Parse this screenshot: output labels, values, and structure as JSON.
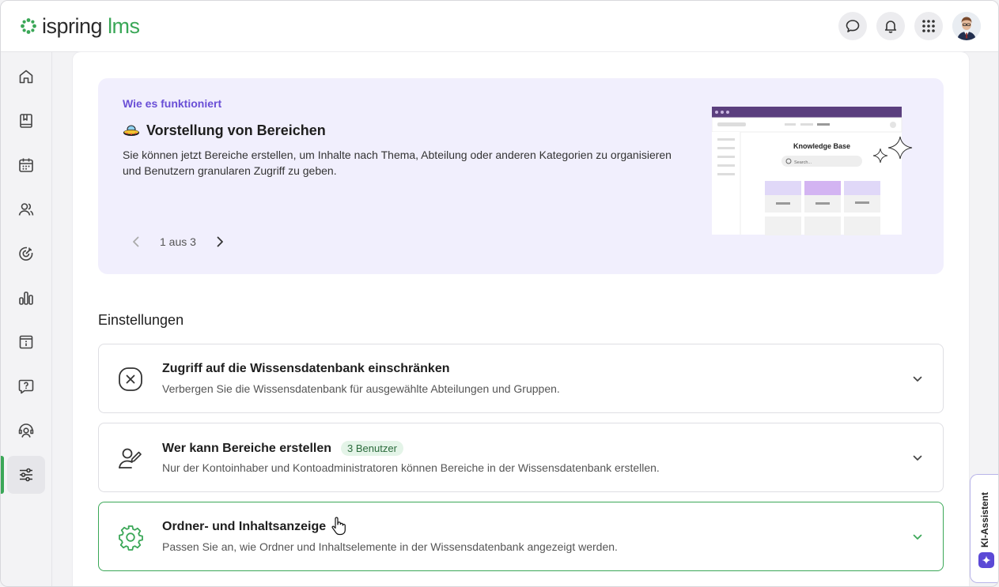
{
  "app": {
    "logo_text_main": "ispring",
    "logo_text_accent": "lms",
    "brand_color": "#3aa757",
    "accent_purple": "#6a4fd6"
  },
  "header": {
    "icons": [
      "chat-icon",
      "bell-icon",
      "apps-grid-icon",
      "avatar"
    ]
  },
  "sidebar": {
    "items": [
      {
        "icon": "home-icon"
      },
      {
        "icon": "book-icon"
      },
      {
        "icon": "calendar-icon"
      },
      {
        "icon": "users-icon"
      },
      {
        "icon": "target-icon"
      },
      {
        "icon": "bar-chart-icon"
      },
      {
        "icon": "info-box-icon"
      },
      {
        "icon": "question-chat-icon"
      },
      {
        "icon": "support-icon"
      },
      {
        "icon": "settings-sliders-icon",
        "active": true
      }
    ]
  },
  "banner": {
    "eyebrow": "Wie es funktioniert",
    "title": "Vorstellung von Bereichen",
    "text": "Sie können jetzt Bereiche erstellen, um Inhalte nach Thema, Abteilung oder anderen Kategorien zu organisieren und Benutzern granularen Zugriff zu geben.",
    "pager": "1 aus 3",
    "illustration": {
      "title": "Knowledge Base",
      "search_placeholder": "Search..."
    }
  },
  "settings": {
    "section_title": "Einstellungen",
    "items": [
      {
        "title": "Zugriff auf die Wissensdatenbank einschränken",
        "description": "Verbergen Sie die Wissensdatenbank für ausgewählte Abteilungen und Gruppen.",
        "icon": "close-circle-icon"
      },
      {
        "title": "Wer kann Bereiche erstellen",
        "badge": "3 Benutzer",
        "description": "Nur der Kontoinhaber und Kontoadministratoren können Bereiche in der Wissensdatenbank erstellen.",
        "icon": "user-edit-icon"
      },
      {
        "title": "Ordner- und Inhaltsanzeige",
        "description": "Passen Sie an, wie Ordner und Inhaltselemente in der Wissensdatenbank angezeigt werden.",
        "icon": "gear-icon",
        "highlighted": true
      }
    ]
  },
  "ai_assistant": {
    "label": "KI-Assistent"
  }
}
